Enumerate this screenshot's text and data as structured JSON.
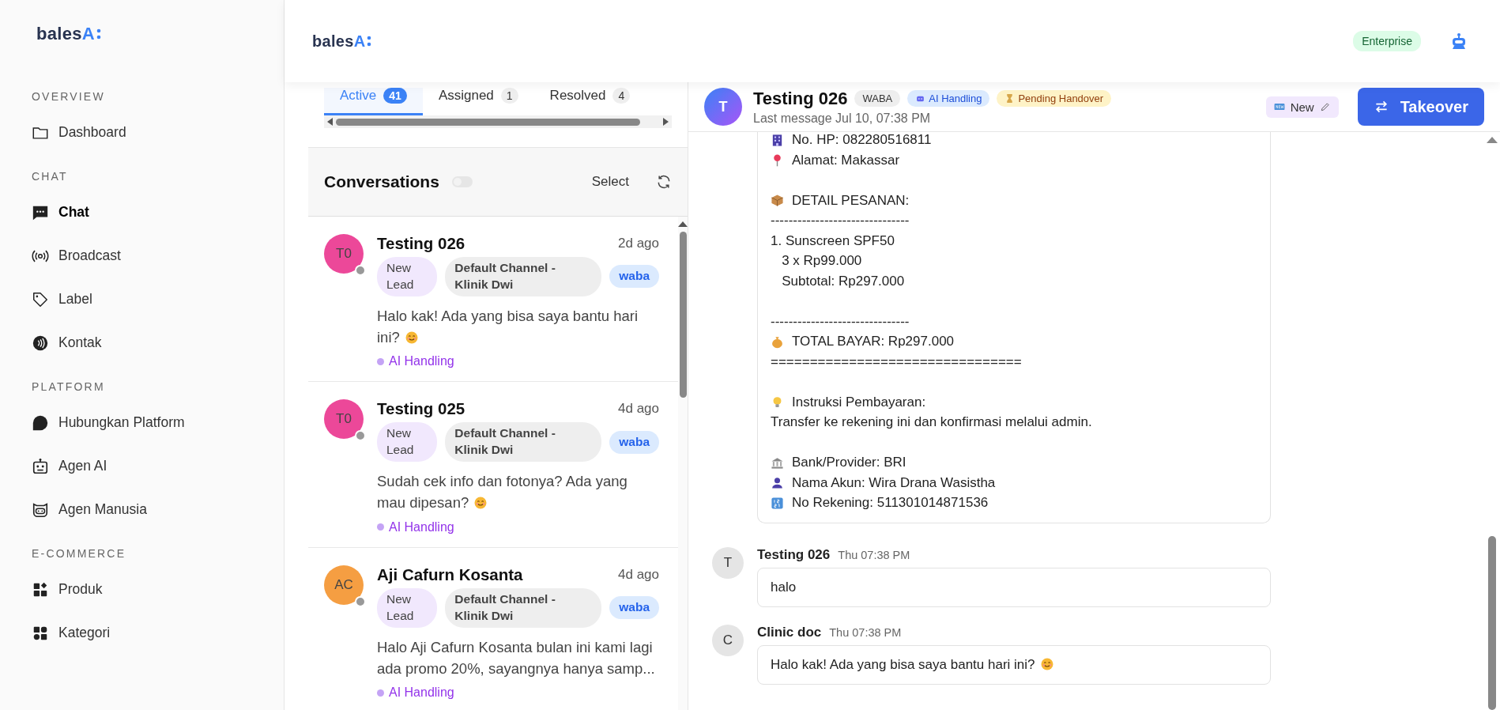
{
  "sidebar": {
    "logo": {
      "text": "bales",
      "accent": "A"
    },
    "sections": [
      {
        "title": "OVERVIEW",
        "items": [
          {
            "label": "Dashboard",
            "selected": false
          }
        ]
      },
      {
        "title": "CHAT",
        "items": [
          {
            "label": "Chat",
            "selected": true
          },
          {
            "label": "Broadcast",
            "selected": false
          },
          {
            "label": "Label",
            "selected": false
          },
          {
            "label": "Kontak",
            "selected": false
          }
        ]
      },
      {
        "title": "PLATFORM",
        "items": [
          {
            "label": "Hubungkan Platform",
            "selected": false
          },
          {
            "label": "Agen AI",
            "selected": false
          },
          {
            "label": "Agen Manusia",
            "selected": false
          }
        ]
      },
      {
        "title": "E-COMMERCE",
        "items": [
          {
            "label": "Produk",
            "selected": false
          },
          {
            "label": "Kategori",
            "selected": false
          }
        ]
      }
    ]
  },
  "topbar": {
    "logo": {
      "text": "bales",
      "accent": "A"
    },
    "plan": "Enterprise"
  },
  "tabs": [
    {
      "label": "Active",
      "count": "41",
      "selected": true
    },
    {
      "label": "Assigned",
      "count": "1",
      "selected": false
    },
    {
      "label": "Resolved",
      "count": "4",
      "selected": false
    }
  ],
  "conversations": {
    "title": "Conversations",
    "toggle": {
      "on": false
    },
    "select": "Select",
    "items": [
      {
        "avatar": "T0",
        "color": "#ec4899",
        "name": "Testing 026",
        "time": "2d ago",
        "tags": [
          {
            "kind": "lead",
            "label": "New Lead"
          },
          {
            "kind": "channel",
            "label": "Default Channel - Klinik Dwi"
          },
          {
            "kind": "platform",
            "label": "waba"
          }
        ],
        "preview": "Halo kak! Ada yang bisa saya bantu hari ini?",
        "trailing_emoji": true,
        "status": "AI Handling"
      },
      {
        "avatar": "T0",
        "color": "#ec4899",
        "name": "Testing 025",
        "time": "4d ago",
        "tags": [
          {
            "kind": "lead",
            "label": "New Lead"
          },
          {
            "kind": "channel",
            "label": "Default Channel - Klinik Dwi"
          },
          {
            "kind": "platform",
            "label": "waba"
          }
        ],
        "preview": "Sudah cek info dan fotonya? Ada yang mau dipesan?",
        "trailing_emoji": true,
        "status": "AI Handling"
      },
      {
        "avatar": "AC",
        "color": "#f59e42",
        "name": "Aji Cafurn Kosanta",
        "time": "4d ago",
        "tags": [
          {
            "kind": "lead",
            "label": "New Lead"
          },
          {
            "kind": "channel",
            "label": "Default Channel - Klinik Dwi"
          },
          {
            "kind": "platform",
            "label": "waba"
          }
        ],
        "preview": "Halo Aji Cafurn Kosanta bulan ini kami lagi ada promo 20%, sayangnya hanya samp...",
        "trailing_emoji": false,
        "status": "AI Handling"
      }
    ]
  },
  "chat": {
    "header": {
      "avatar": "T",
      "title": "Testing 026",
      "tags": [
        {
          "kind": "channel",
          "label": "WABA"
        },
        {
          "kind": "ai",
          "label": "AI Handling"
        },
        {
          "kind": "pending",
          "label": "Pending Handover"
        }
      ],
      "subtitle": "Last message Jul 10, 07:38 PM",
      "status_tag": "New",
      "action": "Takeover"
    },
    "messages": [
      {
        "kind": "card",
        "lines": [
          {
            "kind": "icon",
            "text": "No. HP: 082280516811"
          },
          {
            "kind": "icon",
            "text": "Alamat: Makassar"
          },
          {
            "kind": "blank"
          },
          {
            "kind": "icon",
            "text": "DETAIL PESANAN:"
          },
          {
            "kind": "text",
            "text": "-------------------------------"
          },
          {
            "kind": "text",
            "text": "1. Sunscreen SPF50"
          },
          {
            "kind": "text",
            "text": "   3 x Rp99.000"
          },
          {
            "kind": "text",
            "text": "   Subtotal: Rp297.000"
          },
          {
            "kind": "blank"
          },
          {
            "kind": "text",
            "text": "-------------------------------"
          },
          {
            "kind": "icon",
            "text": "TOTAL BAYAR: Rp297.000"
          },
          {
            "kind": "text",
            "text": "================================"
          },
          {
            "kind": "blank"
          },
          {
            "kind": "icon",
            "text": "Instruksi Pembayaran:"
          },
          {
            "kind": "text",
            "text": "Transfer ke rekening ini dan konfirmasi melalui admin."
          },
          {
            "kind": "blank"
          },
          {
            "kind": "icon",
            "text": "Bank/Provider: BRI"
          },
          {
            "kind": "icon",
            "text": "Nama Akun: Wira Drana Wasistha"
          },
          {
            "kind": "icon",
            "text": "No Rekening: 511301014871536"
          }
        ]
      },
      {
        "kind": "bubble",
        "avatar": "T",
        "sender": "Testing 026",
        "time": "Thu 07:38 PM",
        "text": "halo",
        "trailing_emoji": false
      },
      {
        "kind": "bubble",
        "avatar": "C",
        "sender": "Clinic doc",
        "time": "Thu 07:38 PM",
        "text": "Halo kak! Ada yang bisa saya bantu hari ini?",
        "trailing_emoji": true
      }
    ]
  }
}
